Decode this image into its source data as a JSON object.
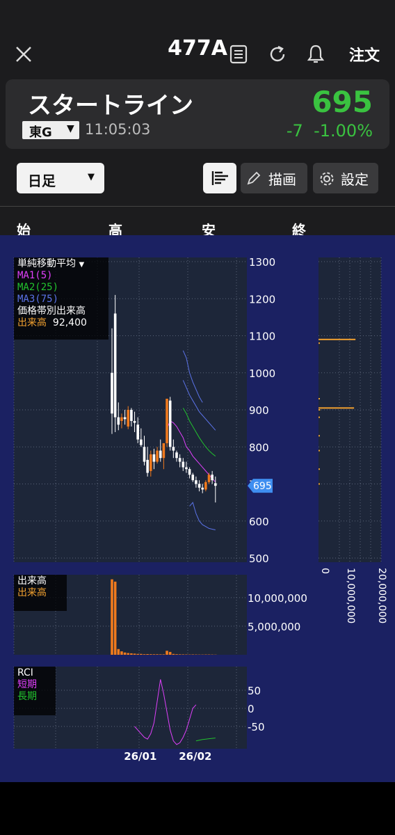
{
  "header": {
    "ticker": "477A",
    "order_label": "注文"
  },
  "stock": {
    "name": "スタートライン",
    "market": "東G",
    "time": "11:05:03",
    "price": "695",
    "change": "-7",
    "change_pct": "-1.00%"
  },
  "toolbar": {
    "period": "日足",
    "draw_label": "描画",
    "settings_label": "設定"
  },
  "ohlc": {
    "open": "始",
    "high": "高",
    "low": "安",
    "close": "終"
  },
  "legend": {
    "title": "単純移動平均",
    "ma1": "MA1(5)",
    "ma2": "MA2(25)",
    "ma3": "MA3(75)",
    "vp": "価格帯別出来高",
    "vol_label": "出来高",
    "vol_value": "92,400"
  },
  "vol_legend": {
    "title": "出来高",
    "series": "出来高"
  },
  "rci_legend": {
    "title": "RCI",
    "short": "短期",
    "long": "長期"
  },
  "colors": {
    "up": "#f07a1e",
    "down": "#ffffff",
    "ma1": "#e040fb",
    "ma2": "#22c32e",
    "ma3": "#5b73e8",
    "vp": "#f0a030"
  },
  "chart_data": [
    {
      "type": "candlestick",
      "ylim": [
        500,
        1300
      ],
      "y_ticks": [
        "1300",
        "1200",
        "1100",
        "1000",
        "900",
        "800",
        "700",
        "600",
        "500"
      ],
      "x_ticks": [
        "26/01",
        "26/02"
      ],
      "current_price_label": "695",
      "candles": [
        {
          "o": 1000,
          "h": 1120,
          "l": 835,
          "c": 890
        },
        {
          "o": 1160,
          "h": 1210,
          "l": 840,
          "c": 880
        },
        {
          "o": 880,
          "h": 920,
          "l": 845,
          "c": 860
        },
        {
          "o": 870,
          "h": 890,
          "l": 850,
          "c": 880
        },
        {
          "o": 880,
          "h": 900,
          "l": 860,
          "c": 875
        },
        {
          "o": 855,
          "h": 910,
          "l": 848,
          "c": 900
        },
        {
          "o": 900,
          "h": 905,
          "l": 855,
          "c": 870
        },
        {
          "o": 870,
          "h": 895,
          "l": 840,
          "c": 865
        },
        {
          "o": 860,
          "h": 880,
          "l": 810,
          "c": 820
        },
        {
          "o": 820,
          "h": 850,
          "l": 800,
          "c": 805
        },
        {
          "o": 800,
          "h": 830,
          "l": 750,
          "c": 760
        },
        {
          "o": 765,
          "h": 800,
          "l": 720,
          "c": 730
        },
        {
          "o": 735,
          "h": 790,
          "l": 720,
          "c": 780
        },
        {
          "o": 780,
          "h": 795,
          "l": 740,
          "c": 760
        },
        {
          "o": 760,
          "h": 800,
          "l": 755,
          "c": 790
        },
        {
          "o": 790,
          "h": 820,
          "l": 760,
          "c": 770
        },
        {
          "o": 770,
          "h": 810,
          "l": 740,
          "c": 810
        },
        {
          "o": 810,
          "h": 930,
          "l": 800,
          "c": 930
        },
        {
          "o": 925,
          "h": 935,
          "l": 790,
          "c": 800
        },
        {
          "o": 800,
          "h": 820,
          "l": 770,
          "c": 790
        },
        {
          "o": 785,
          "h": 790,
          "l": 760,
          "c": 770
        },
        {
          "o": 770,
          "h": 780,
          "l": 745,
          "c": 760
        },
        {
          "o": 760,
          "h": 770,
          "l": 735,
          "c": 745
        },
        {
          "o": 745,
          "h": 760,
          "l": 730,
          "c": 740
        },
        {
          "o": 740,
          "h": 745,
          "l": 715,
          "c": 725
        },
        {
          "o": 725,
          "h": 730,
          "l": 705,
          "c": 710
        },
        {
          "o": 710,
          "h": 720,
          "l": 690,
          "c": 700
        },
        {
          "o": 700,
          "h": 710,
          "l": 680,
          "c": 690
        },
        {
          "o": 690,
          "h": 700,
          "l": 675,
          "c": 685
        },
        {
          "o": 685,
          "h": 710,
          "l": 680,
          "c": 705
        },
        {
          "o": 705,
          "h": 730,
          "l": 700,
          "c": 725
        },
        {
          "o": 725,
          "h": 735,
          "l": 700,
          "c": 710
        },
        {
          "o": 702,
          "h": 720,
          "l": 650,
          "c": 695
        }
      ],
      "ma_series": [
        {
          "name": "MA1(5)",
          "start": 17,
          "values": [
            850,
            870,
            865,
            855,
            840,
            825,
            800,
            790,
            775,
            765,
            755,
            745,
            735,
            725,
            715,
            705
          ]
        },
        {
          "name": "MA2(25)",
          "start": 22,
          "values": [
            905,
            890,
            870,
            855,
            840,
            825,
            812,
            800,
            790,
            782,
            775
          ]
        },
        {
          "name": "MA3(75)",
          "start": 22,
          "values": [
            1060,
            1040,
            1000,
            975,
            955,
            935,
            920
          ]
        },
        {
          "name": "MA3(75) lower band",
          "start": 22,
          "values": [
            980,
            960,
            940,
            925,
            910,
            895,
            885,
            875,
            865,
            855,
            845
          ]
        },
        {
          "name": "MA3(75) lower band 2",
          "start": 24,
          "values": [
            640,
            650,
            620,
            600,
            590,
            585,
            580,
            578,
            576
          ]
        }
      ]
    },
    {
      "type": "bar",
      "name": "出来高",
      "y_ticks": [
        "10,000,000",
        "5,000,000"
      ],
      "ylim": [
        0,
        14000000
      ],
      "values": [
        13200000,
        12800000,
        1000000,
        600000,
        400000,
        300000,
        250000,
        200000,
        150000,
        150000,
        100000,
        120000,
        100000,
        90000,
        90000,
        80000,
        80000,
        700000,
        500000,
        150000,
        100000,
        80000,
        70000,
        60000,
        50000,
        60000,
        50000,
        40000,
        40000,
        50000,
        50000,
        40000,
        30000
      ]
    },
    {
      "type": "line",
      "name": "RCI",
      "y_ticks": [
        "50",
        "0",
        "-50"
      ],
      "ylim": [
        -100,
        100
      ],
      "series": [
        {
          "name": "短期",
          "start": 7,
          "values": [
            -50,
            -60,
            -70,
            -80,
            -85,
            -70,
            -40,
            20,
            80,
            40,
            -10,
            -60,
            -90,
            -100,
            -95,
            -80,
            -60,
            -30,
            0,
            10
          ]
        },
        {
          "name": "長期",
          "start": 26,
          "values": [
            -90,
            -88,
            -86,
            -85,
            -84,
            -83,
            -82
          ]
        }
      ]
    },
    {
      "type": "hbar",
      "name": "価格帯別出来高",
      "x_ticks": [
        "0",
        "10,000,000",
        "20,000,000"
      ],
      "xlim": [
        0,
        22000000
      ],
      "bins": [
        {
          "price": 1090,
          "value": 13000000
        },
        {
          "price": 1080,
          "value": 200000
        },
        {
          "price": 930,
          "value": 200000
        },
        {
          "price": 905,
          "value": 12500000
        },
        {
          "price": 900,
          "value": 600000
        },
        {
          "price": 880,
          "value": 400000
        },
        {
          "price": 830,
          "value": 300000
        },
        {
          "price": 790,
          "value": 100000
        },
        {
          "price": 740,
          "value": 100000
        },
        {
          "price": 700,
          "value": 100000
        }
      ]
    }
  ]
}
